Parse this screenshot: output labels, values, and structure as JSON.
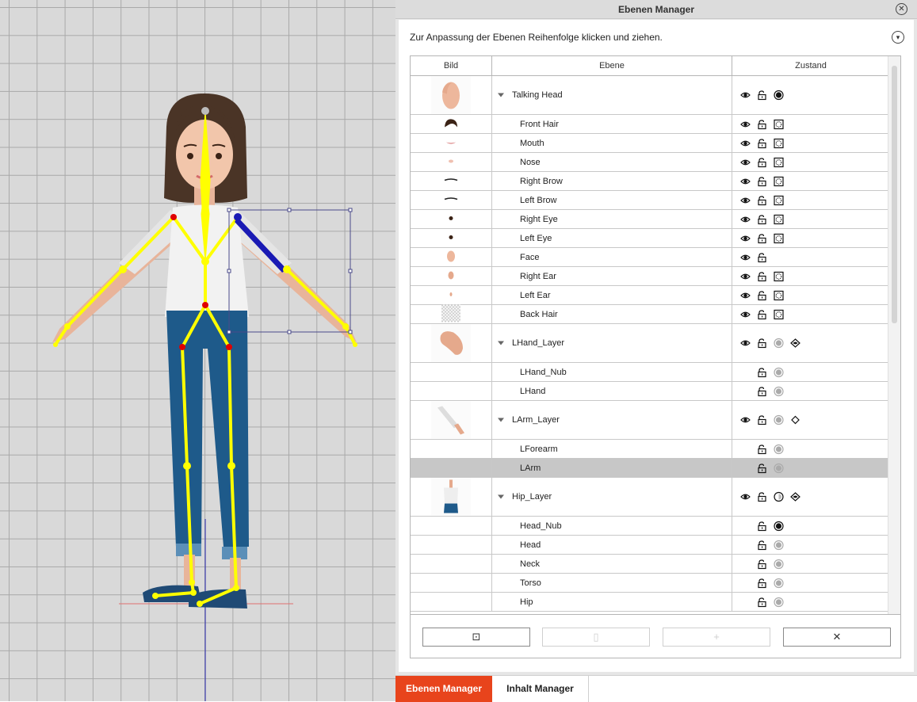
{
  "panel": {
    "title": "Ebenen Manager",
    "hint": "Zur Anpassung der Ebenen Reihenfolge klicken und ziehen."
  },
  "table": {
    "headers": {
      "bild": "Bild",
      "ebene": "Ebene",
      "zustand": "Zustand"
    },
    "rows": [
      {
        "name": "Talking Head",
        "group": true,
        "thumb": "head",
        "eye": true,
        "lock": true,
        "state": "solid",
        "extra": "none"
      },
      {
        "name": "Front Hair",
        "group": false,
        "thumb": "hair",
        "eye": true,
        "lock": true,
        "state": "dotted",
        "extra": "none"
      },
      {
        "name": "Mouth",
        "group": false,
        "thumb": "mouth",
        "eye": true,
        "lock": true,
        "state": "dotted",
        "extra": "none"
      },
      {
        "name": "Nose",
        "group": false,
        "thumb": "nose",
        "eye": true,
        "lock": true,
        "state": "dotted",
        "extra": "none"
      },
      {
        "name": "Right Brow",
        "group": false,
        "thumb": "brow",
        "eye": true,
        "lock": true,
        "state": "dotted",
        "extra": "none"
      },
      {
        "name": "Left Brow",
        "group": false,
        "thumb": "brow",
        "eye": true,
        "lock": true,
        "state": "dotted",
        "extra": "none"
      },
      {
        "name": "Right Eye",
        "group": false,
        "thumb": "eye",
        "eye": true,
        "lock": true,
        "state": "dotted",
        "extra": "none"
      },
      {
        "name": "Left Eye",
        "group": false,
        "thumb": "eye",
        "eye": true,
        "lock": true,
        "state": "dotted",
        "extra": "none"
      },
      {
        "name": "Face",
        "group": false,
        "thumb": "face",
        "eye": true,
        "lock": true,
        "state": "none",
        "extra": "none"
      },
      {
        "name": "Right Ear",
        "group": false,
        "thumb": "ear",
        "eye": true,
        "lock": true,
        "state": "dotted",
        "extra": "none"
      },
      {
        "name": "Left Ear",
        "group": false,
        "thumb": "earsmall",
        "eye": true,
        "lock": true,
        "state": "dotted",
        "extra": "none"
      },
      {
        "name": "Back Hair",
        "group": false,
        "thumb": "checker",
        "eye": true,
        "lock": true,
        "state": "dotted",
        "extra": "none"
      },
      {
        "name": "LHand_Layer",
        "group": true,
        "thumb": "hand",
        "eye": true,
        "lock": true,
        "state": "grey",
        "extra": "diamond-eye"
      },
      {
        "name": "LHand_Nub",
        "group": false,
        "thumb": "",
        "eye": false,
        "lock": true,
        "state": "grey",
        "extra": "none"
      },
      {
        "name": "LHand",
        "group": false,
        "thumb": "",
        "eye": false,
        "lock": true,
        "state": "grey",
        "extra": "none"
      },
      {
        "name": "LArm_Layer",
        "group": true,
        "thumb": "arm",
        "eye": true,
        "lock": true,
        "state": "grey",
        "extra": "diamond"
      },
      {
        "name": "LForearm",
        "group": false,
        "thumb": "",
        "eye": false,
        "lock": true,
        "state": "grey",
        "extra": "none"
      },
      {
        "name": "LArm",
        "group": false,
        "thumb": "",
        "eye": false,
        "lock": true,
        "state": "grey",
        "extra": "none",
        "selected": true
      },
      {
        "name": "Hip_Layer",
        "group": true,
        "thumb": "body",
        "eye": true,
        "lock": true,
        "state": "half",
        "extra": "diamond-eye"
      },
      {
        "name": "Head_Nub",
        "group": false,
        "thumb": "",
        "eye": false,
        "lock": true,
        "state": "solid",
        "extra": "none"
      },
      {
        "name": "Head",
        "group": false,
        "thumb": "",
        "eye": false,
        "lock": true,
        "state": "grey",
        "extra": "none"
      },
      {
        "name": "Neck",
        "group": false,
        "thumb": "",
        "eye": false,
        "lock": true,
        "state": "grey",
        "extra": "none"
      },
      {
        "name": "Torso",
        "group": false,
        "thumb": "",
        "eye": false,
        "lock": true,
        "state": "grey",
        "extra": "none"
      },
      {
        "name": "Hip",
        "group": false,
        "thumb": "",
        "eye": false,
        "lock": true,
        "state": "grey",
        "extra": "none"
      }
    ]
  },
  "footer": {
    "buttons": [
      {
        "icon": "import-icon",
        "glyph": "⊡",
        "enabled": true
      },
      {
        "icon": "duplicate-icon",
        "glyph": "▯",
        "enabled": false
      },
      {
        "icon": "add-icon",
        "glyph": "+",
        "enabled": false
      },
      {
        "icon": "delete-icon",
        "glyph": "✕",
        "enabled": true
      }
    ]
  },
  "tabs": {
    "ebenen": "Ebenen Manager",
    "inhalt": "Inhalt Manager"
  },
  "colors": {
    "accent": "#e8441c",
    "bone": "#ffff00",
    "joint": "#e00000",
    "selected_bone": "#1a1ab4",
    "grid": "#a9a9a9"
  }
}
